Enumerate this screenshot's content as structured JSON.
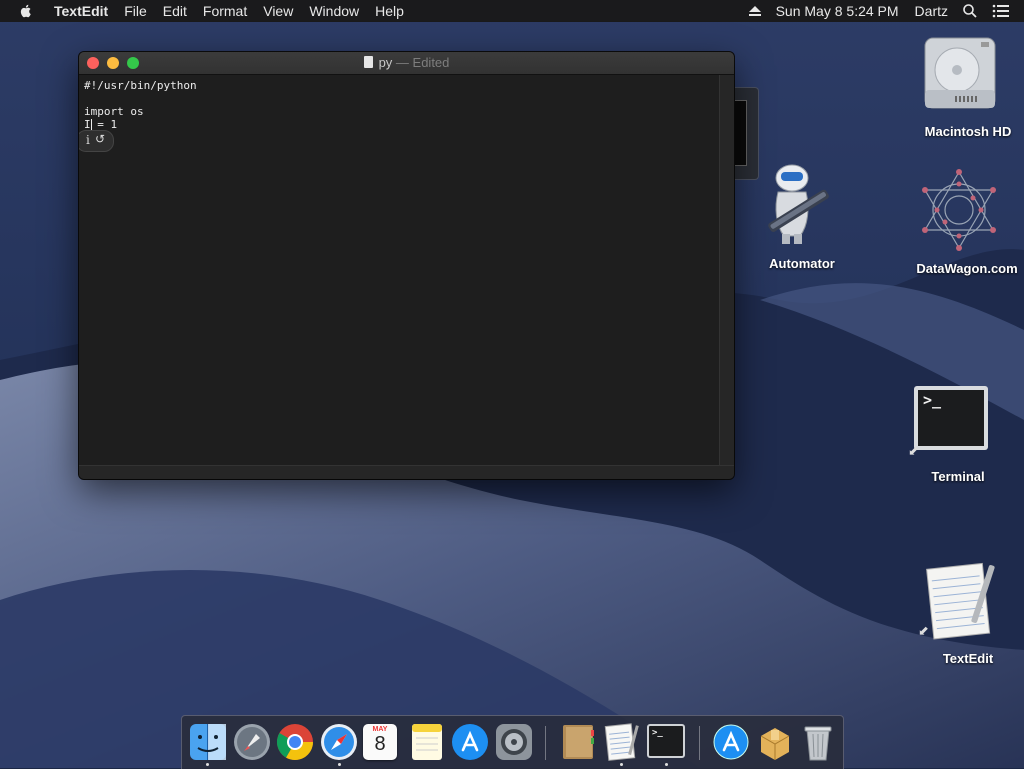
{
  "menubar": {
    "app_name": "TextEdit",
    "menus": [
      "File",
      "Edit",
      "Format",
      "View",
      "Window",
      "Help"
    ],
    "clock": "Sun May 8  5:24 PM",
    "user": "Dartz",
    "icons": [
      "apple-icon",
      "eject-icon",
      "spotlight-search-icon",
      "notification-center-icon"
    ]
  },
  "window": {
    "title": "py",
    "title_suffix": " — Edited",
    "content": {
      "line1": "#!/usr/bin/python",
      "line2": "import os",
      "line3": "I = 1"
    },
    "suggestion_info": "i",
    "suggestion_undo": "↺"
  },
  "desktop": {
    "icons": [
      {
        "label": "Macintosh HD",
        "icon": "hard-drive-icon"
      },
      {
        "label": "Automator",
        "icon": "automator-robot-icon"
      },
      {
        "label": "DataWagon.com",
        "icon": "network-volume-icon"
      },
      {
        "label": "Terminal",
        "icon": "terminal-icon",
        "terminal_prompt": ">_"
      },
      {
        "label": "TextEdit",
        "icon": "textedit-icon"
      }
    ]
  },
  "dock": {
    "apps": [
      "finder-icon",
      "launchpad-icon",
      "chrome-icon",
      "safari-icon",
      "calendar-icon",
      "notes-icon",
      "app-store-icon",
      "system-preferences-icon",
      "contacts-icon",
      "textedit-icon",
      "terminal-icon",
      "app-store-downloads-icon",
      "archive-utility-icon",
      "trash-icon"
    ],
    "calendar_month": "MAY",
    "calendar_day": "8",
    "terminal_prompt": ">_"
  },
  "colors": {
    "close": "#fc615d",
    "minimize": "#fdbc40",
    "zoom": "#34c84a",
    "menubar": "#1a1a1c",
    "wallpaper": "#1b2745"
  }
}
